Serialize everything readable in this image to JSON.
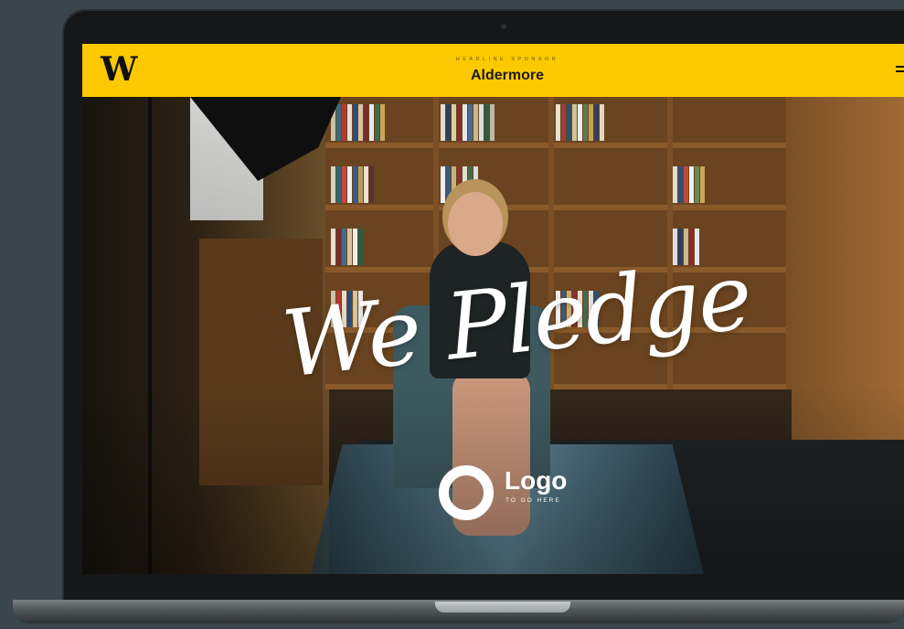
{
  "header": {
    "brand": "W",
    "sponsor_label": "HEADLINE SPONSOR",
    "sponsor_name": "Aldermore"
  },
  "hero": {
    "title": "We Pledge"
  },
  "partner": {
    "name": "Logo",
    "tagline": "TO GO HERE"
  },
  "colors": {
    "header_bg": "#fcc900",
    "title": "#ffffff"
  }
}
